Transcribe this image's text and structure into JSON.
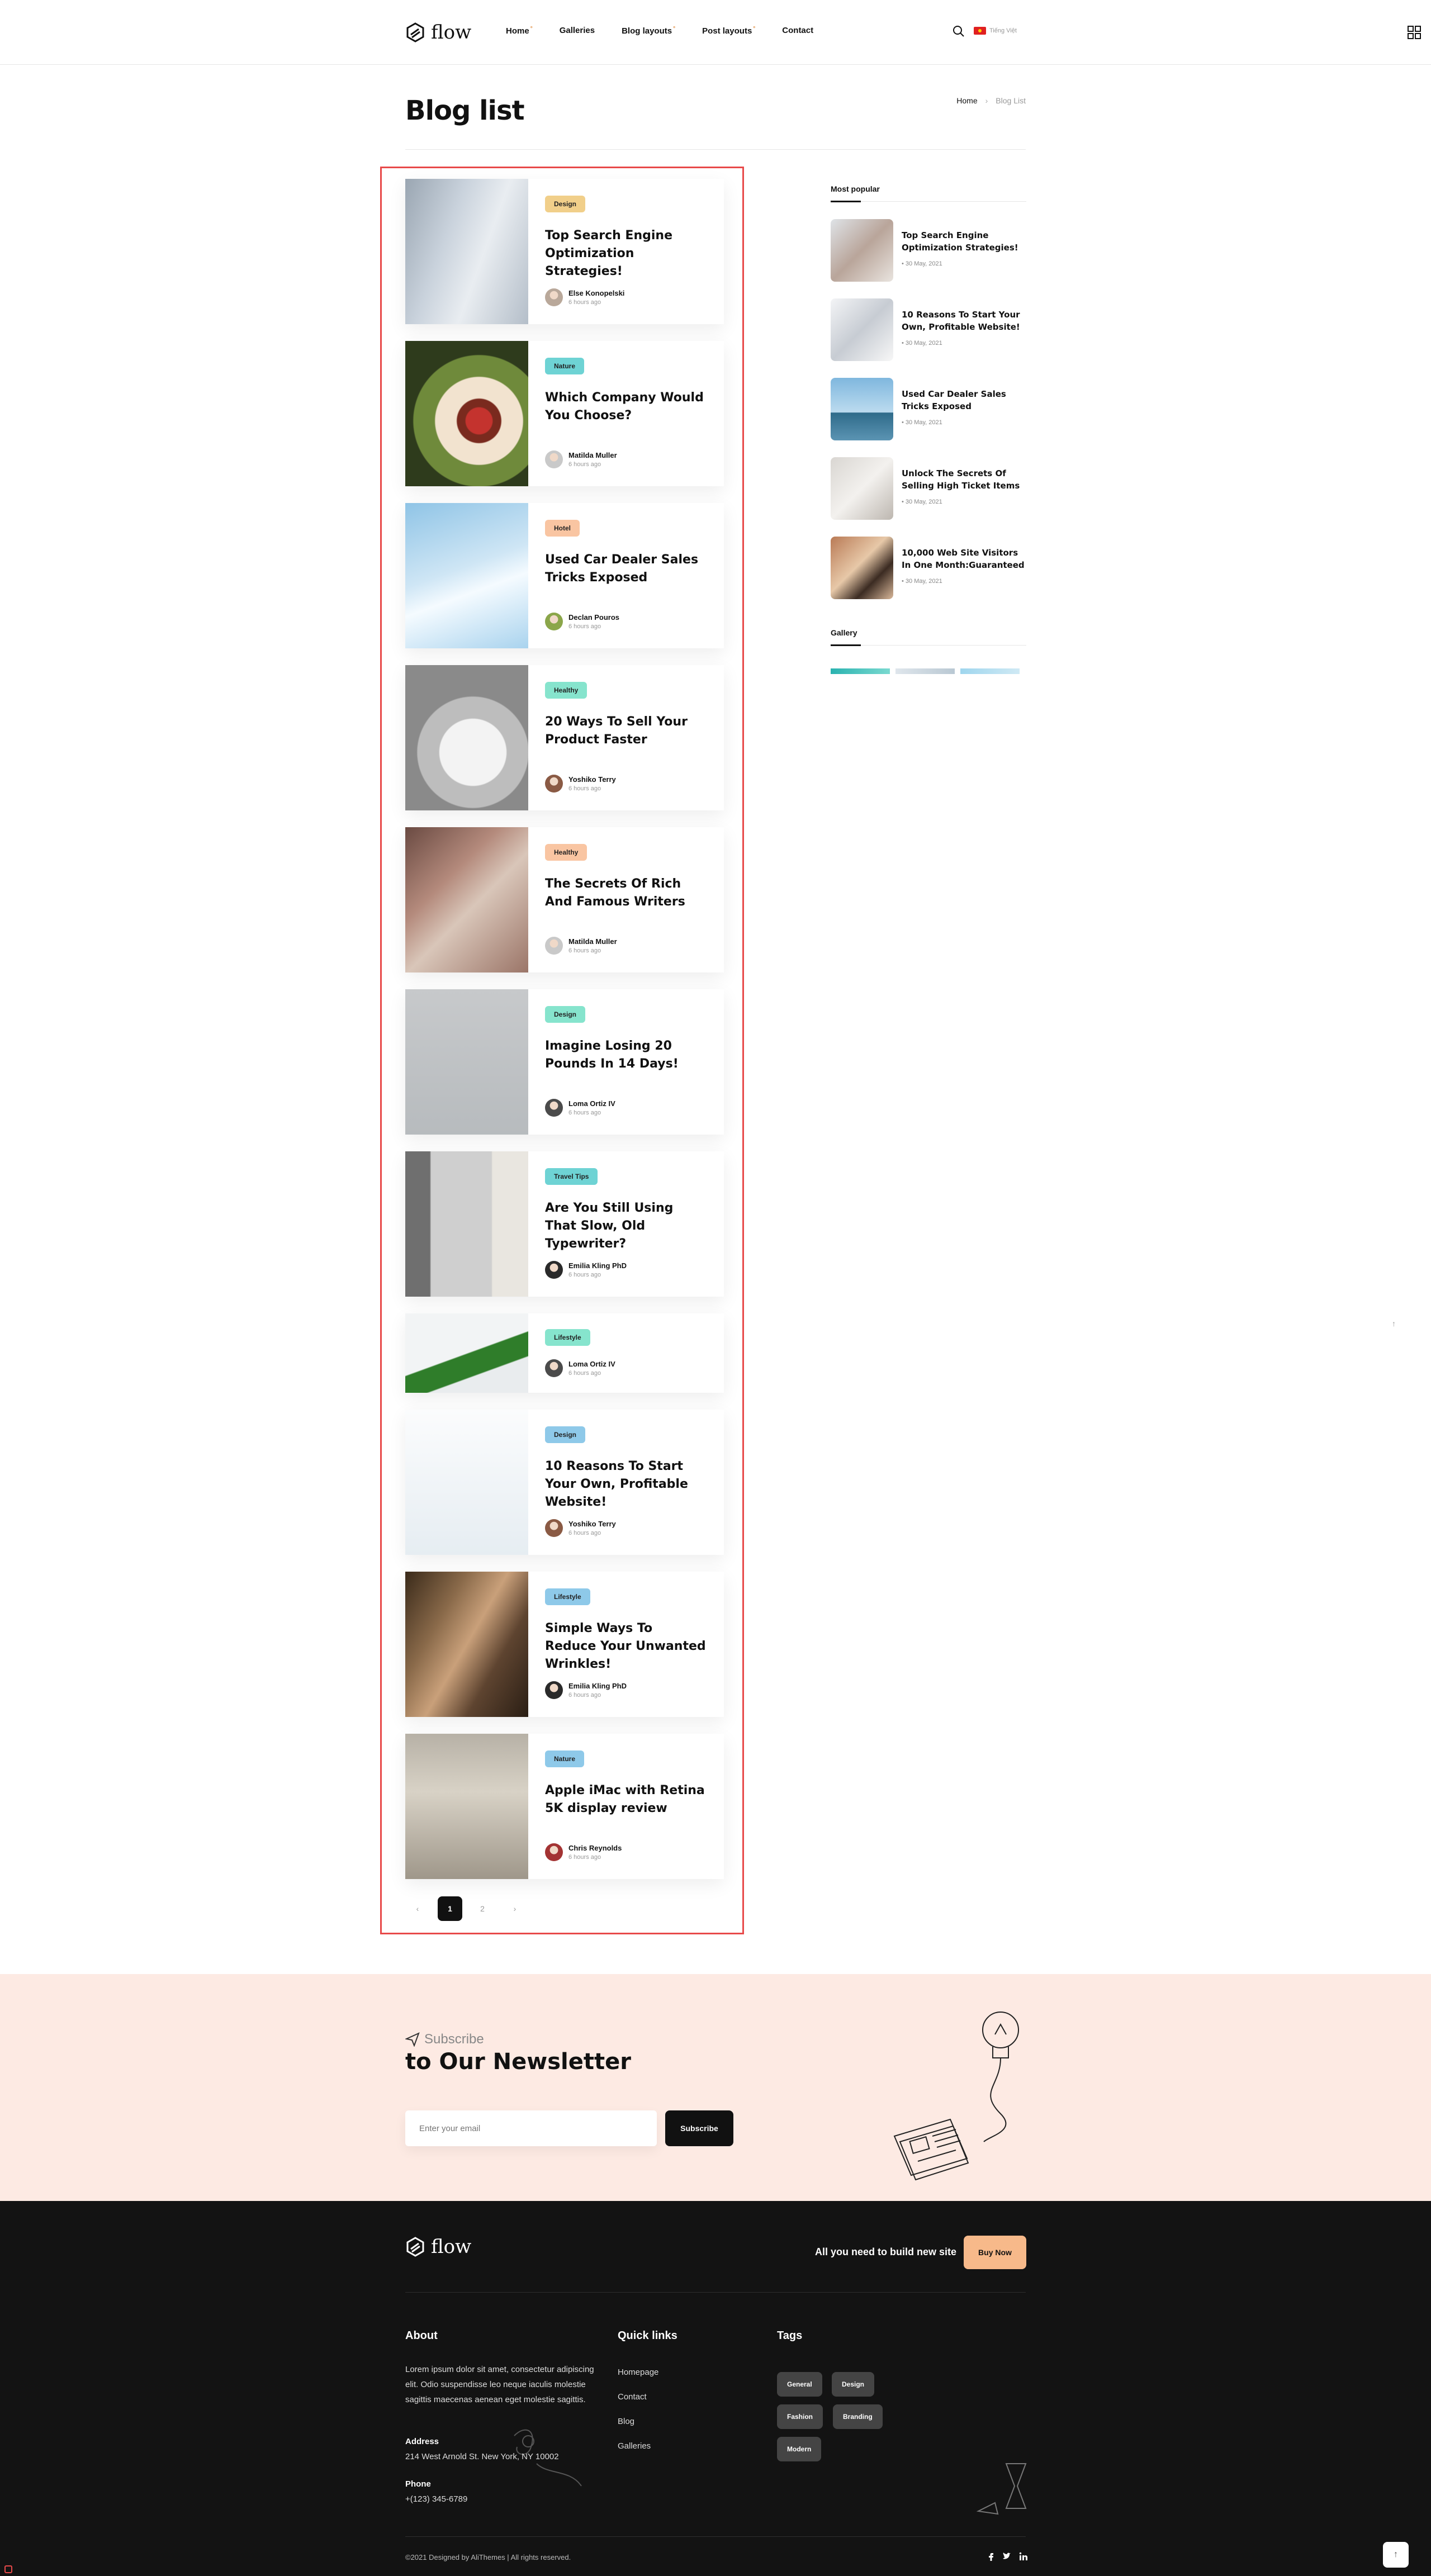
{
  "header": {
    "logo_text": "flow",
    "nav": [
      {
        "label": "Home",
        "has_dropdown": true
      },
      {
        "label": "Galleries",
        "has_dropdown": false
      },
      {
        "label": "Blog layouts",
        "has_dropdown": true
      },
      {
        "label": "Post layouts",
        "has_dropdown": true
      },
      {
        "label": "Contact",
        "has_dropdown": false
      }
    ],
    "dropdown_marker": "°",
    "lang_label": "Tiếng Việt"
  },
  "page": {
    "title": "Blog list",
    "breadcrumb": [
      "Home",
      "Blog List"
    ],
    "breadcrumb_sep": "›"
  },
  "posts": [
    {
      "category": "Design",
      "badge_color": "#f1cf8a",
      "title": "Top Search Engine Optimization Strategies!",
      "author": "Else Konopelski",
      "time": "6 hours ago"
    },
    {
      "category": "Nature",
      "badge_color": "#6ed3d4",
      "title": "Which Company Would You Choose?",
      "author": "Matilda Muller",
      "time": "6 hours ago"
    },
    {
      "category": "Hotel",
      "badge_color": "#f9c5a2",
      "title": "Used Car Dealer Sales Tricks Exposed",
      "author": "Declan Pouros",
      "time": "6 hours ago"
    },
    {
      "category": "Healthy",
      "badge_color": "#86e4cd",
      "title": "20 Ways To Sell Your Product Faster",
      "author": "Yoshiko Terry",
      "time": "6 hours ago"
    },
    {
      "category": "Healthy",
      "badge_color": "#f9c5a2",
      "title": "The Secrets Of Rich And Famous Writers",
      "author": "Matilda Muller",
      "time": "6 hours ago"
    },
    {
      "category": "Design",
      "badge_color": "#86e4cd",
      "title": "Imagine Losing 20 Pounds In 14 Days!",
      "author": "Loma Ortiz IV",
      "time": "6 hours ago"
    },
    {
      "category": "Travel Tips",
      "badge_color": "#6ed3d4",
      "title": "Are You Still Using That Slow, Old Typewriter?",
      "author": "Emilia Kling PhD",
      "time": "6 hours ago"
    },
    {
      "category": "Lifestyle",
      "badge_color": "#86e4cd",
      "title": "",
      "author": "Loma Ortiz IV",
      "time": "6 hours ago"
    },
    {
      "category": "Design",
      "badge_color": "#8ec9e9",
      "title": "10 Reasons To Start Your Own, Profitable Website!",
      "author": "Yoshiko Terry",
      "time": "6 hours ago"
    },
    {
      "category": "Lifestyle",
      "badge_color": "#8ec9e9",
      "title": "Simple Ways To Reduce Your Unwanted Wrinkles!",
      "author": "Emilia Kling PhD",
      "time": "6 hours ago"
    },
    {
      "category": "Nature",
      "badge_color": "#8ec9e9",
      "title": "Apple iMac with Retina 5K display review",
      "author": "Chris Reynolds",
      "time": "6 hours ago"
    }
  ],
  "pagination": {
    "prev": "‹",
    "pages": [
      "1",
      "2"
    ],
    "next": "›",
    "current": "1"
  },
  "sidebar": {
    "popular_heading": "Most popular",
    "popular": [
      {
        "title": "Top Search Engine Optimization Strategies!",
        "date": "30 May, 2021"
      },
      {
        "title": "10 Reasons To Start Your Own, Profitable Website!",
        "date": "30 May, 2021"
      },
      {
        "title": "Used Car Dealer Sales Tricks Exposed",
        "date": "30 May, 2021"
      },
      {
        "title": "Unlock The Secrets Of Selling High Ticket Items",
        "date": "30 May, 2021"
      },
      {
        "title": "10,000 Web Site Visitors In One Month:Guaranteed",
        "date": "30 May, 2021"
      }
    ],
    "gallery_heading": "Gallery"
  },
  "newsletter": {
    "subtitle": "Subscribe",
    "title": "to Our Newsletter",
    "placeholder": "Enter your email",
    "button": "Subscribe"
  },
  "footer": {
    "logo_text": "flow",
    "tagline": "All you need to build new site",
    "buy_button": "Buy Now",
    "about_heading": "About",
    "about_text": "Lorem ipsum dolor sit amet, consectetur adipiscing elit. Odio suspendisse leo neque iaculis molestie sagittis maecenas aenean eget molestie sagittis.",
    "address_label": "Address",
    "address": "214 West Arnold St. New York, NY 10002",
    "phone_label": "Phone",
    "phone": "+(123) 345-6789",
    "quick_heading": "Quick links",
    "quick_links": [
      "Homepage",
      "Contact",
      "Blog",
      "Galleries"
    ],
    "tags_heading": "Tags",
    "tags": [
      "General",
      "Design",
      "Fashion",
      "Branding",
      "Modern"
    ],
    "copyright": "©2021 Designed by AliThemes | All rights reserved.",
    "to_top": "↑"
  },
  "side_arrow": "↑"
}
